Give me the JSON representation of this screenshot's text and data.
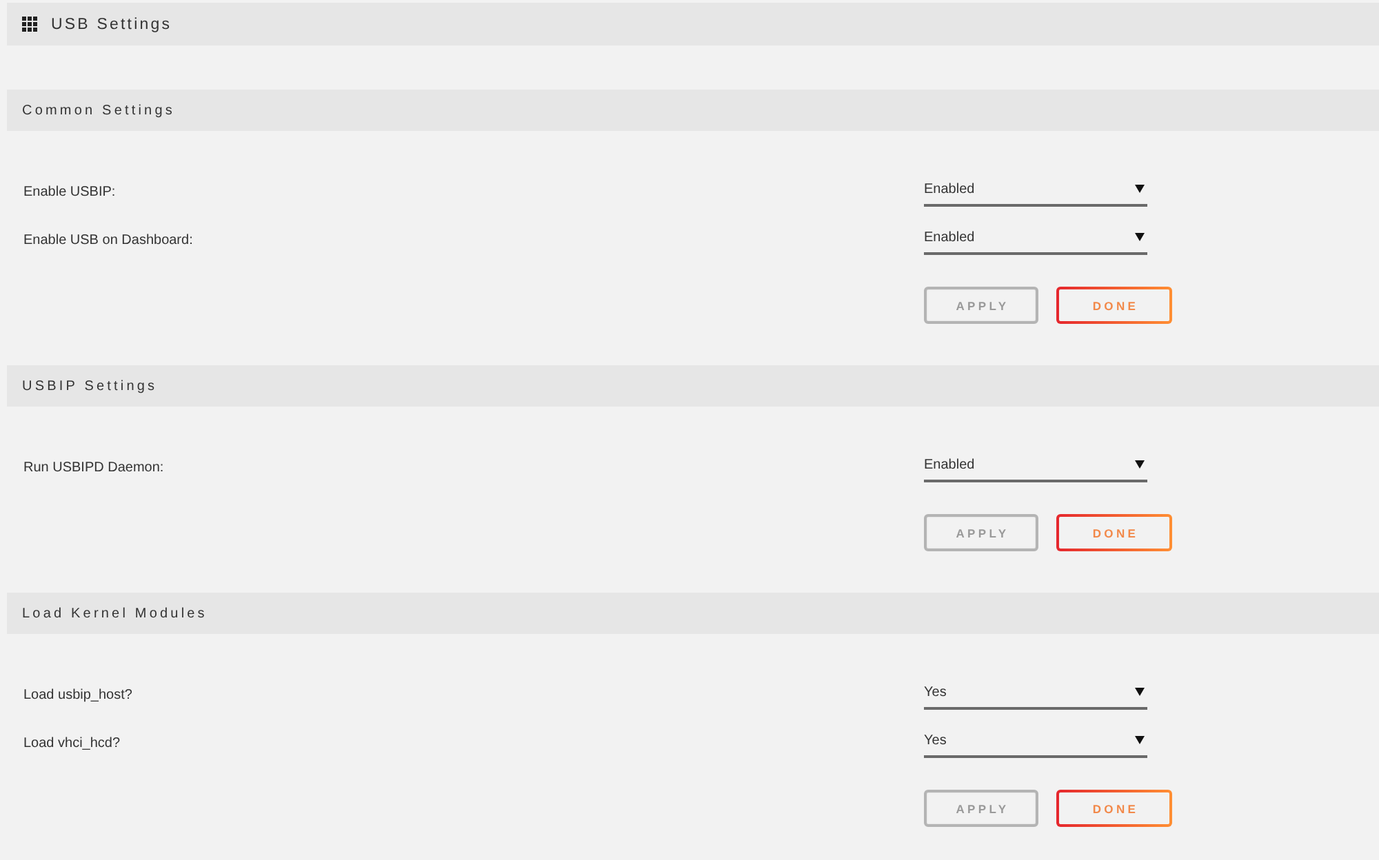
{
  "header": {
    "title": "USB Settings"
  },
  "sections": [
    {
      "title": "Common Settings",
      "settings": [
        {
          "label": "Enable USBIP:",
          "value": "Enabled"
        },
        {
          "label": "Enable USB on Dashboard:",
          "value": "Enabled"
        }
      ],
      "buttons": [
        {
          "label": "APPLY",
          "disabled": true
        },
        {
          "label": "DONE",
          "disabled": false
        }
      ]
    },
    {
      "title": "USBIP Settings",
      "settings": [
        {
          "label": "Run USBIPD Daemon:",
          "value": "Enabled"
        }
      ],
      "buttons": [
        {
          "label": "APPLY",
          "disabled": true
        },
        {
          "label": "DONE",
          "disabled": false
        }
      ]
    },
    {
      "title": "Load Kernel Modules",
      "settings": [
        {
          "label": "Load usbip_host?",
          "value": "Yes"
        },
        {
          "label": "Load vhci_hcd?",
          "value": "Yes"
        }
      ],
      "buttons": [
        {
          "label": "APPLY",
          "disabled": true
        },
        {
          "label": "DONE",
          "disabled": false
        }
      ]
    }
  ]
}
